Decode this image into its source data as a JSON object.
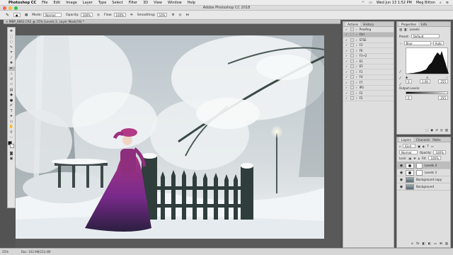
{
  "menubar": {
    "app_name": "Photoshop CC",
    "items": [
      "File",
      "Edit",
      "Image",
      "Layer",
      "Type",
      "Select",
      "Filter",
      "3D",
      "View",
      "Window",
      "Help"
    ],
    "datetime": "Wed Jun 13  1:52 PM",
    "user": "Meg Bitton"
  },
  "window": {
    "title": "Adobe Photoshop CC 2018"
  },
  "options_bar": {
    "mode_label": "Mode:",
    "mode_value": "Normal",
    "opacity_label": "Opacity:",
    "opacity_value": "100%",
    "flow_label": "Flow:",
    "flow_value": "100%",
    "smoothing_label": "Smoothing:",
    "smoothing_value": "10%"
  },
  "document_tab": {
    "label": "MBP_6062.CR2 @ 25% (Levels 2, Layer Mask/16) *"
  },
  "status_bar": {
    "zoom": "25%",
    "doc_info": "Doc: 102.9M/233.4M"
  },
  "actions_panel": {
    "tabs": [
      "Actions",
      "History"
    ],
    "items": [
      {
        "label": "Proofing",
        "checked": true,
        "selected": false
      },
      {
        "label": "Ctrl",
        "checked": true,
        "selected": true
      },
      {
        "label": "STSE",
        "checked": true,
        "selected": false
      },
      {
        "label": "F3",
        "checked": true,
        "selected": false
      },
      {
        "label": "F6",
        "checked": true,
        "selected": false
      },
      {
        "label": "F3+2",
        "checked": true,
        "selected": false
      },
      {
        "label": "E1",
        "checked": true,
        "selected": false
      },
      {
        "label": "E5",
        "checked": true,
        "selected": false
      },
      {
        "label": "F1",
        "checked": true,
        "selected": false
      },
      {
        "label": "F4",
        "checked": true,
        "selected": false
      },
      {
        "label": "F7",
        "checked": true,
        "selected": false
      },
      {
        "label": "IPS",
        "checked": true,
        "selected": false
      },
      {
        "label": "F2",
        "checked": true,
        "selected": false
      },
      {
        "label": "F2",
        "checked": true,
        "selected": false
      }
    ]
  },
  "properties_panel": {
    "tabs": [
      "Properties",
      "Info"
    ],
    "title": "Levels",
    "preset_label": "Preset:",
    "preset_value": "Default",
    "channel_value": "Blue",
    "auto_label": "Auto",
    "input_values": [
      "0",
      "1.00",
      "255"
    ],
    "output_label": "Output Levels:",
    "output_values": [
      "0",
      "255"
    ]
  },
  "layers_panel": {
    "tabs": [
      "Layers",
      "Channels",
      "Paths"
    ],
    "kind_label": "Kind",
    "blend_mode": "Normal",
    "opacity_label": "Opacity:",
    "opacity_value": "100%",
    "lock_label": "Lock:",
    "fill_label": "Fill:",
    "fill_value": "100%",
    "layers": [
      {
        "name": "Levels 2",
        "type": "adjustment",
        "selected": true
      },
      {
        "name": "Levels 1",
        "type": "adjustment",
        "selected": false
      },
      {
        "name": "Background copy",
        "type": "image",
        "selected": false
      },
      {
        "name": "Background",
        "type": "image",
        "selected": false
      }
    ]
  },
  "toolbar": {
    "tools": [
      "move-icon",
      "marquee-icon",
      "lasso-icon",
      "quick-select-icon",
      "crop-icon",
      "eyedropper-icon",
      "healing-icon",
      "brush-icon",
      "clone-stamp-icon",
      "history-brush-icon",
      "eraser-icon",
      "gradient-icon",
      "blur-icon",
      "dodge-icon",
      "pen-icon",
      "type-icon",
      "path-select-icon",
      "shape-icon",
      "hand-icon",
      "zoom-icon"
    ],
    "active_tool": "brush-icon"
  },
  "colors": {
    "menubar_bg": "#ececec",
    "panel_bg": "#dedede",
    "workspace": "#535353",
    "traffic_red": "#fc5f57",
    "traffic_yellow": "#fdbc2e",
    "traffic_green": "#28c840"
  }
}
